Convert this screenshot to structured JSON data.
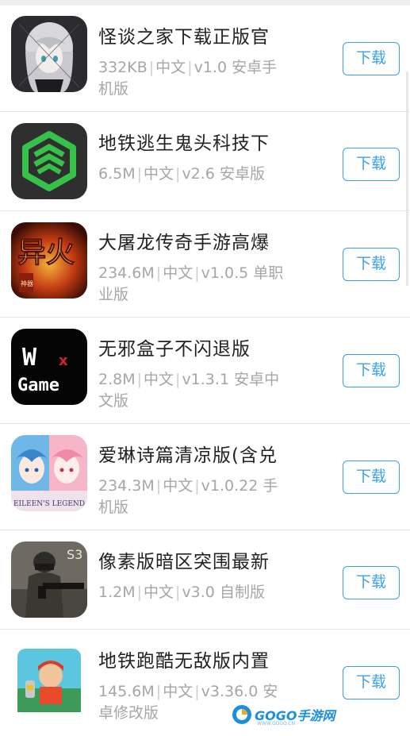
{
  "apps": [
    {
      "title": "怪谈之家下载正版官",
      "size": "332KB",
      "lang": "中文",
      "version": "v1.0",
      "tag_line1": "安卓手",
      "tag_line2": "机版",
      "download_label": "下载",
      "icon": "anime-girl-icon"
    },
    {
      "title": "地铁逃生鬼头科技下",
      "size": "6.5M",
      "lang": "中文",
      "version": "v2.6",
      "tag_line1": "安卓版",
      "tag_line2": "",
      "download_label": "下载",
      "icon": "green-hexagon-logo-icon"
    },
    {
      "title": "大屠龙传奇手游高爆",
      "size": "234.6M",
      "lang": "中文",
      "version": "v1.0.5",
      "tag_line1": "单职",
      "tag_line2": "业版",
      "download_label": "下载",
      "icon": "fire-calligraphy-icon",
      "icon_text": "异火",
      "icon_badge": "神器"
    },
    {
      "title": "无邪盒子不闪退版",
      "size": "2.8M",
      "lang": "中文",
      "version": "v1.3.1",
      "tag_line1": "安卓中",
      "tag_line2": "文版",
      "download_label": "下载",
      "icon": "wx-game-logo-icon",
      "icon_text_1": "W",
      "icon_text_x": "x",
      "icon_text_2": "Game"
    },
    {
      "title": "爱琳诗篇清凉版(含兑",
      "size": "234.3M",
      "lang": "中文",
      "version": "v1.0.22",
      "tag_line1": "手",
      "tag_line2": "机版",
      "download_label": "下载",
      "icon": "anime-duo-icon",
      "icon_text": "EILEEN'S LEGEND"
    },
    {
      "title": "像素版暗区突围最新",
      "size": "1.2M",
      "lang": "中文",
      "version": "v3.0",
      "tag_line1": "自制版",
      "tag_line2": "",
      "download_label": "下载",
      "icon": "soldier-icon",
      "icon_text": "S3"
    },
    {
      "title": "地铁跑酷无敌版内置",
      "size": "145.6M",
      "lang": "中文",
      "version": "v3.36.0",
      "tag_line1": "安",
      "tag_line2": "卓修改版",
      "download_label": "下载",
      "icon": "subway-runner-icon"
    }
  ],
  "watermark": {
    "text": "GOGO手游网",
    "sub": "WWW.GOGO.CN"
  },
  "colors": {
    "accent": "#3aa0ea",
    "title": "#222222",
    "meta": "#a6a6a6"
  }
}
